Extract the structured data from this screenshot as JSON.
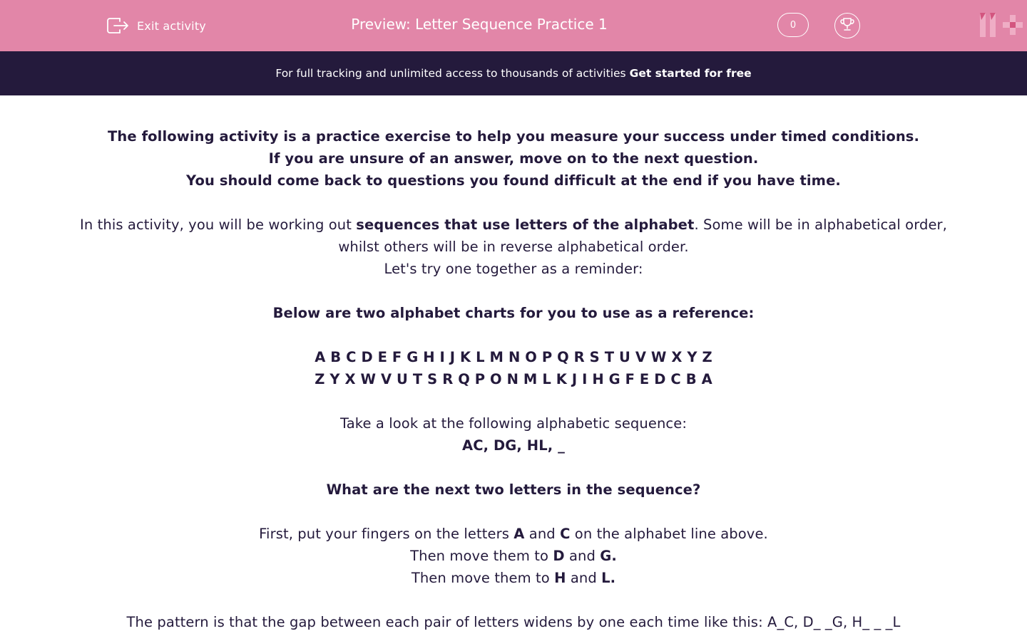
{
  "header": {
    "exit_label": "Exit activity",
    "title": "Preview: Letter Sequence Practice 1",
    "score": "0",
    "exit_icon": "exit-icon",
    "trophy_icon": "trophy-icon",
    "logo": "11+ logo"
  },
  "banner": {
    "text": "For full tracking and unlimited access to thousands of activities",
    "cta": "Get started for free"
  },
  "content": {
    "intro": [
      "The following activity is a practice exercise to help you measure your success under timed conditions.",
      "If you are unsure of an answer, move on to the next question.",
      "You should come back to questions you found difficult at the end if you have time."
    ],
    "para1_before": "In this activity, you will be working out ",
    "para1_bold": "sequences that use letters of the alphabet",
    "para1_after": ". Some will be in alphabetical order, whilst others will be in reverse alphabetical order.",
    "reminder": "Let's try one together as a reminder:",
    "charts_heading": "Below are two alphabet charts for you to use as a reference:",
    "alphabet_forward": "A B C D E F G H I J K L M N O P Q R S T U V W X Y Z",
    "alphabet_reverse": "Z Y X W V U T S R Q P O N M L K J I H G F E D C B A",
    "look_text": "Take a look at the following alphabetic sequence:",
    "sequence": "AC, DG, HL, _",
    "question": "What are the next two letters in the sequence?",
    "step1": {
      "before": "First, put your fingers on the letters ",
      "l1": "A",
      "mid": " and ",
      "l2": "C",
      "after": " on the alphabet line above."
    },
    "step2": {
      "before": "Then move them to ",
      "l1": "D",
      "mid": " and ",
      "l2": "G."
    },
    "step3": {
      "before": "Then move them to ",
      "l1": "H",
      "mid": " and ",
      "l2": "L."
    },
    "pattern": "The pattern is that the gap between each pair of letters widens by one each time like this: A_C, D_ _G, H_ _ _L"
  },
  "colors": {
    "topbar": "#e286a8",
    "banner": "#241a3c",
    "text": "#241a3c"
  }
}
